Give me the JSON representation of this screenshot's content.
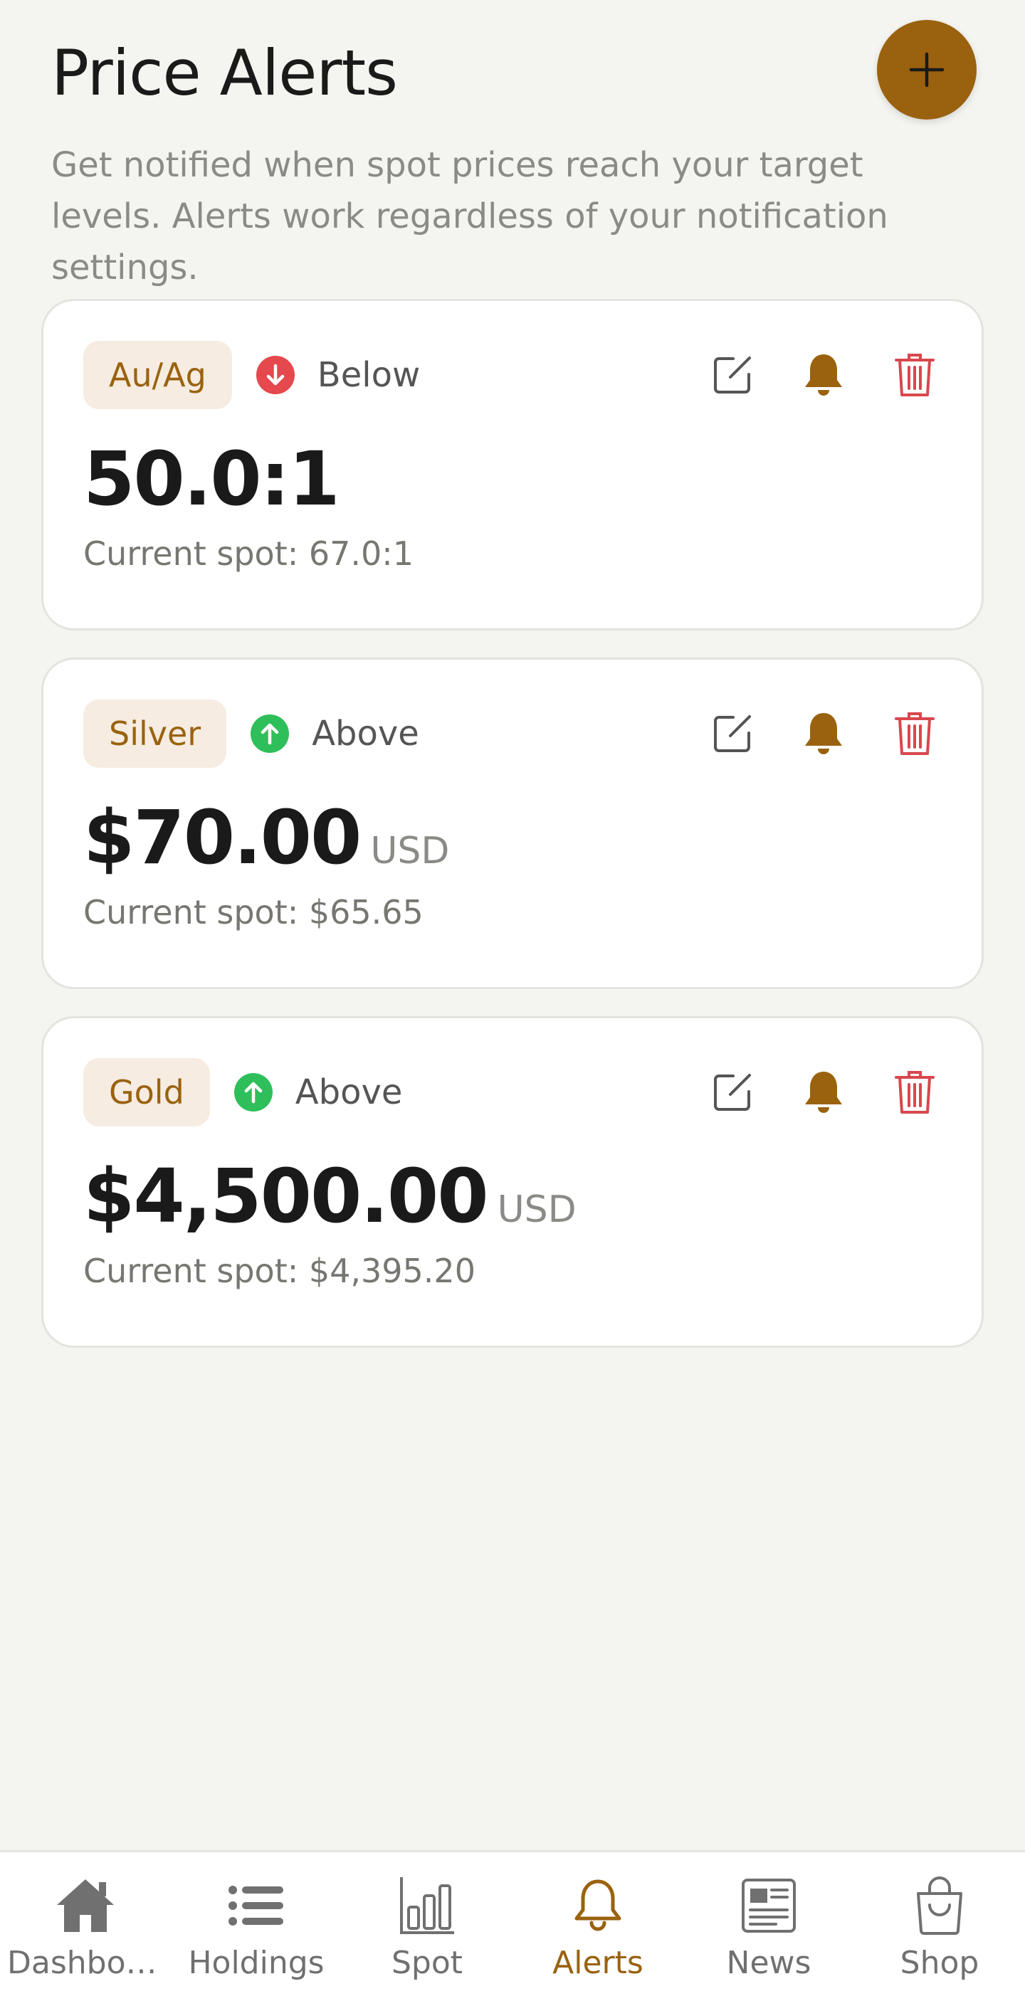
{
  "header": {
    "title": "Price Alerts",
    "subtitle": "Get notified when spot prices reach your target levels. Alerts work regardless of your notification settings.",
    "add_icon": "plus-icon"
  },
  "alerts": [
    {
      "metal": "Au/Ag",
      "direction": "Below",
      "direction_color": "#e5484d",
      "target": "50.0:1",
      "unit": "",
      "current_spot": "Current spot: 67.0:1"
    },
    {
      "metal": "Silver",
      "direction": "Above",
      "direction_color": "#2fbf5a",
      "target": "$70.00",
      "unit": "USD",
      "current_spot": "Current spot: $65.65"
    },
    {
      "metal": "Gold",
      "direction": "Above",
      "direction_color": "#2fbf5a",
      "target": "$4,500.00",
      "unit": "USD",
      "current_spot": "Current spot: $4,395.20"
    }
  ],
  "nav": {
    "items": [
      {
        "label": "Dashboa...",
        "icon": "home-icon"
      },
      {
        "label": "Holdings",
        "icon": "list-icon"
      },
      {
        "label": "Spot",
        "icon": "bar-chart-icon"
      },
      {
        "label": "Alerts",
        "icon": "bell-icon",
        "active": true
      },
      {
        "label": "News",
        "icon": "newspaper-icon"
      },
      {
        "label": "Shop",
        "icon": "shopping-bag-icon"
      }
    ]
  },
  "colors": {
    "accent": "#9a620f",
    "danger": "#d9474e",
    "up": "#2fbf5a",
    "down": "#e5484d"
  }
}
